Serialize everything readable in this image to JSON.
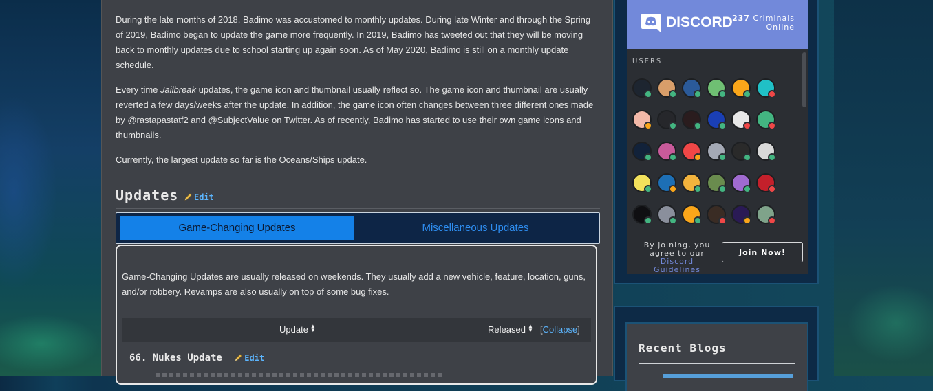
{
  "article": {
    "para1": "During the late months of 2018, Badimo was accustomed to monthly updates. During late Winter and through the Spring of 2019, Badimo began to update the game more frequently. In 2019, Badimo has tweeted out that they will be moving back to monthly updates due to school starting up again soon. As of May 2020, Badimo is still on a monthly update schedule.",
    "para2_pre": "Every time ",
    "para2_em": "Jailbreak",
    "para2_post": " updates, the game icon and thumbnail usually reflect so. The game icon and thumbnail are usually reverted a few days/weeks after the update. In addition, the game icon often changes between three different ones made by @rastapastatf2 and @SubjectValue on Twitter. As of recently, Badimo has started to use their own game icons and thumbnails.",
    "para3": "Currently, the largest update so far is the Oceans/Ships update.",
    "section_title": "Updates",
    "edit_label": "Edit"
  },
  "tabs": [
    {
      "label": "Game-Changing Updates",
      "active": true
    },
    {
      "label": "Miscellaneous Updates",
      "active": false
    }
  ],
  "panel": {
    "description": "Game-Changing Updates are usually released on weekends. They usually add a new vehicle, feature, location, guns, and/or robbery. Revamps are also usually on top of some bug fixes.",
    "table": {
      "col_update": "Update",
      "col_released": "Released",
      "collapse_label": "Collapse"
    },
    "subsection_title": "66. Nukes Update",
    "edit_label": "Edit"
  },
  "discord": {
    "brand": "DISCORD",
    "online_count": "237",
    "online_text_1": "Criminals",
    "online_text_2": "Online",
    "users_label": "USERS",
    "footer_line1": "By joining, you",
    "footer_line2": "agree to our",
    "footer_link": "Discord Guidelines",
    "join_label": "Join Now!",
    "accent": "#7289da",
    "avatars": [
      {
        "color": "#1d2530",
        "status": "#43b581"
      },
      {
        "color": "#d89e6a",
        "status": "#43b581"
      },
      {
        "color": "#2b5a99",
        "status": "#43b581"
      },
      {
        "color": "#6fbf73",
        "status": "#43b581"
      },
      {
        "color": "#faa61a",
        "status": "#43b581"
      },
      {
        "color": "#20c0c6",
        "status": "#f04747"
      },
      {
        "color": "#f2b8a8",
        "status": "#faa61a"
      },
      {
        "color": "#26272b",
        "status": "#43b581"
      },
      {
        "color": "#2a1c1e",
        "status": "#43b581"
      },
      {
        "color": "#1a3fb5",
        "status": "#43b581"
      },
      {
        "color": "#e8e8e8",
        "status": "#f04747"
      },
      {
        "color": "#43b581",
        "status": "#f04747"
      },
      {
        "color": "#12223a",
        "status": "#43b581"
      },
      {
        "color": "#c85a9a",
        "status": "#43b581"
      },
      {
        "color": "#f04747",
        "status": "#faa61a"
      },
      {
        "color": "#a4a9b5",
        "status": "#43b581"
      },
      {
        "color": "#2a2a2a",
        "status": "#43b581"
      },
      {
        "color": "#d9d9d9",
        "status": "#43b581"
      },
      {
        "color": "#f2e15c",
        "status": "#43b581"
      },
      {
        "color": "#1d6fb5",
        "status": "#faa61a"
      },
      {
        "color": "#f2b33d",
        "status": "#43b581"
      },
      {
        "color": "#6a8c4e",
        "status": "#43b581"
      },
      {
        "color": "#a06bd0",
        "status": "#43b581"
      },
      {
        "color": "#c4202b",
        "status": "#f04747"
      },
      {
        "color": "#0f0f12",
        "status": "#43b581"
      },
      {
        "color": "#8a8f9c",
        "status": "#43b581"
      },
      {
        "color": "#faa61a",
        "status": "#43b581"
      },
      {
        "color": "#3a2c24",
        "status": "#f04747"
      },
      {
        "color": "#2a1a55",
        "status": "#faa61a"
      },
      {
        "color": "#7fa38a",
        "status": "#f04747"
      }
    ]
  },
  "recent_blogs": {
    "title": "Recent Blogs"
  }
}
